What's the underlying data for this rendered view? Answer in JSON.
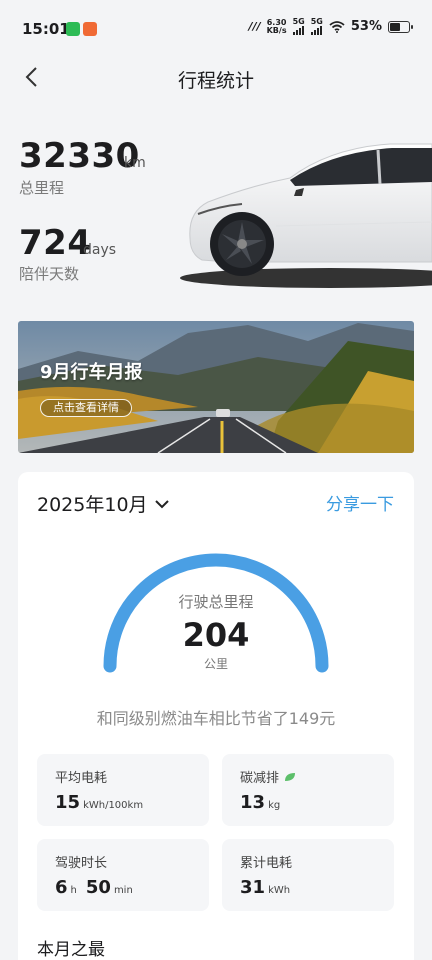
{
  "status_bar": {
    "time": "15:01",
    "network_speed_value": "6.30",
    "network_speed_unit": "KB/s",
    "signal1": "5G",
    "signal2": "5G",
    "battery": "53%",
    "icons": [
      "wechat-icon",
      "app-icon",
      "nfc-icon",
      "signal-icon",
      "wifi-icon",
      "battery-icon"
    ]
  },
  "header": {
    "title": "行程统计",
    "back_icon": "chevron-left-icon"
  },
  "summary": {
    "total_distance": "32330",
    "total_distance_unit": "km",
    "total_distance_label": "总里程",
    "days": "724",
    "days_unit": "days",
    "days_label": "陪伴天数"
  },
  "banner": {
    "title": "9月行车月报",
    "button": "点击查看详情"
  },
  "report": {
    "month": "2025年10月",
    "share": "分享一下",
    "gauge_label": "行驶总里程",
    "gauge_value": "204",
    "gauge_unit": "公里",
    "saving_text": "和同级别燃油车相比节省了149元",
    "tiles": [
      {
        "label": "平均电耗",
        "parts": [
          {
            "n": "15",
            "u": "kWh/100km"
          }
        ]
      },
      {
        "label": "碳减排",
        "leaf_icon": "leaf-icon",
        "parts": [
          {
            "n": "13",
            "u": "kg"
          }
        ]
      },
      {
        "label": "驾驶时长",
        "parts": [
          {
            "n": "6",
            "u": "h"
          },
          {
            "n": "50",
            "u": "min"
          }
        ]
      },
      {
        "label": "累计电耗",
        "parts": [
          {
            "n": "31",
            "u": "kWh"
          }
        ]
      }
    ],
    "section_title": "本月之最"
  },
  "colors": {
    "accent": "#3a9be0",
    "gauge": "#4a9fe4",
    "leaf": "#5cbf6a"
  }
}
